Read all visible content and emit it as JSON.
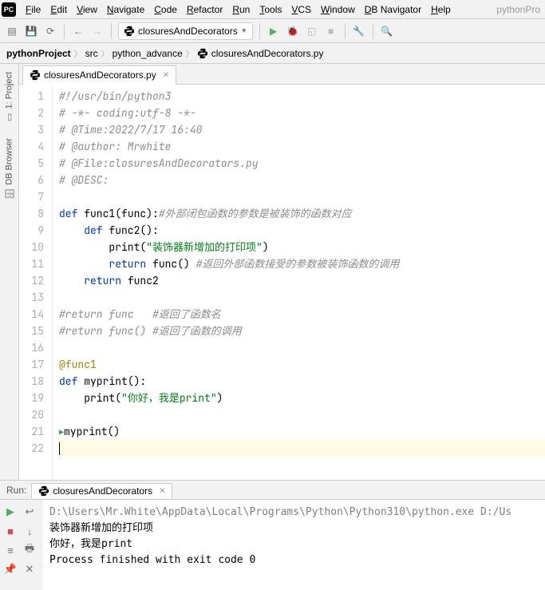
{
  "menubar": {
    "items": [
      "File",
      "Edit",
      "View",
      "Navigate",
      "Code",
      "Refactor",
      "Run",
      "Tools",
      "VCS",
      "Window",
      "DB Navigator",
      "Help"
    ],
    "project_hint": "pythonPro"
  },
  "run_config": {
    "name": "closuresAndDecorators"
  },
  "breadcrumb": {
    "parts": [
      "pythonProject",
      "src",
      "python_advance",
      "closuresAndDecorators.py"
    ]
  },
  "sidebar": {
    "project_label": "1: Project",
    "db_label": "DB Browser"
  },
  "tab": {
    "label": "closuresAndDecorators.py"
  },
  "code": {
    "lines": [
      {
        "n": 1,
        "pre": "",
        "tokens": [
          {
            "t": "#!/usr/bin/python3",
            "c": "cm"
          }
        ]
      },
      {
        "n": 2,
        "pre": "",
        "tokens": [
          {
            "t": "# -*- coding:utf-8 -*-",
            "c": "cm"
          }
        ]
      },
      {
        "n": 3,
        "pre": "",
        "tokens": [
          {
            "t": "# @Time:2022/7/17 16:40",
            "c": "cm"
          }
        ]
      },
      {
        "n": 4,
        "pre": "",
        "tokens": [
          {
            "t": "# @author: Mrwhite",
            "c": "cm"
          }
        ]
      },
      {
        "n": 5,
        "pre": "",
        "tokens": [
          {
            "t": "# @File:closuresAndDecorators.py",
            "c": "cm"
          }
        ]
      },
      {
        "n": 6,
        "pre": "",
        "tokens": [
          {
            "t": "# @DESC:",
            "c": "cm"
          }
        ]
      },
      {
        "n": 7,
        "pre": "",
        "tokens": []
      },
      {
        "n": 8,
        "pre": "",
        "tokens": [
          {
            "t": "def ",
            "c": "kw"
          },
          {
            "t": "func1",
            "c": "fn"
          },
          {
            "t": "(func):",
            "c": ""
          },
          {
            "t": "#外部闭包函数的参数是被装饰的函数对应",
            "c": "cm"
          }
        ]
      },
      {
        "n": 9,
        "pre": "    ",
        "tokens": [
          {
            "t": "def ",
            "c": "kw"
          },
          {
            "t": "func2",
            "c": "fn"
          },
          {
            "t": "():",
            "c": ""
          }
        ]
      },
      {
        "n": 10,
        "pre": "        ",
        "tokens": [
          {
            "t": "print",
            "c": "builtin"
          },
          {
            "t": "(",
            "c": ""
          },
          {
            "t": "\"装饰器新增加的打印项\"",
            "c": "str"
          },
          {
            "t": ")",
            "c": ""
          }
        ]
      },
      {
        "n": 11,
        "pre": "        ",
        "tokens": [
          {
            "t": "return ",
            "c": "kw"
          },
          {
            "t": "func() ",
            "c": ""
          },
          {
            "t": "#返回外部函数接受的参数被装饰函数的调用",
            "c": "cm"
          }
        ]
      },
      {
        "n": 12,
        "pre": "    ",
        "tokens": [
          {
            "t": "return ",
            "c": "kw"
          },
          {
            "t": "func2",
            "c": ""
          }
        ]
      },
      {
        "n": 13,
        "pre": "",
        "tokens": []
      },
      {
        "n": 14,
        "pre": "",
        "tokens": [
          {
            "t": "#return func   #返回了函数名",
            "c": "cm"
          }
        ]
      },
      {
        "n": 15,
        "pre": "",
        "tokens": [
          {
            "t": "#return func() #返回了函数的调用",
            "c": "cm"
          }
        ]
      },
      {
        "n": 16,
        "pre": "",
        "tokens": []
      },
      {
        "n": 17,
        "pre": "",
        "tokens": [
          {
            "t": "@func1",
            "c": "dec"
          }
        ]
      },
      {
        "n": 18,
        "pre": "",
        "tokens": [
          {
            "t": "def ",
            "c": "kw"
          },
          {
            "t": "myprint",
            "c": "fn"
          },
          {
            "t": "():",
            "c": ""
          }
        ]
      },
      {
        "n": 19,
        "pre": "    ",
        "tokens": [
          {
            "t": "print",
            "c": "builtin"
          },
          {
            "t": "(",
            "c": ""
          },
          {
            "t": "\"你好，我是print\"",
            "c": "str"
          },
          {
            "t": ")",
            "c": ""
          }
        ]
      },
      {
        "n": 20,
        "pre": "",
        "tokens": []
      },
      {
        "n": 21,
        "pre": "",
        "tokens": [
          {
            "t": "myprint()",
            "c": ""
          }
        ],
        "runmark": true
      },
      {
        "n": 22,
        "pre": "",
        "tokens": [],
        "cursor": true,
        "hl": true
      }
    ]
  },
  "run_panel": {
    "label": "Run:",
    "tab": "closuresAndDecorators",
    "output": [
      {
        "t": "D:\\Users\\Mr.White\\AppData\\Local\\Programs\\Python\\Python310\\python.exe D:/Us",
        "c": "path"
      },
      {
        "t": "装饰器新增加的打印项",
        "c": ""
      },
      {
        "t": "你好，我是print",
        "c": ""
      },
      {
        "t": "",
        "c": ""
      },
      {
        "t": "Process finished with exit code 0",
        "c": ""
      }
    ]
  }
}
